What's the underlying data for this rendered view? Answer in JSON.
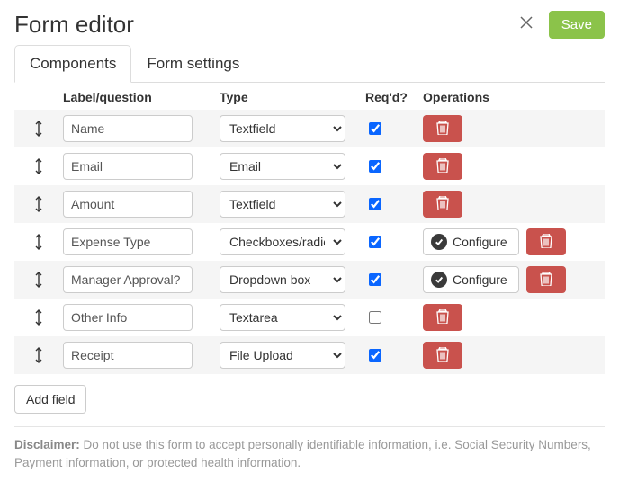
{
  "header": {
    "title": "Form editor",
    "save_label": "Save"
  },
  "tabs": {
    "components": "Components",
    "form_settings": "Form settings"
  },
  "columns": {
    "label": "Label/question",
    "type": "Type",
    "reqd": "Req'd?",
    "ops": "Operations"
  },
  "type_options": [
    "Textfield",
    "Email",
    "Textarea",
    "Checkboxes/radios",
    "Dropdown box",
    "File Upload"
  ],
  "rows": [
    {
      "label": "Name",
      "type": "Textfield",
      "required": true,
      "configurable": false
    },
    {
      "label": "Email",
      "type": "Email",
      "required": true,
      "configurable": false
    },
    {
      "label": "Amount",
      "type": "Textfield",
      "required": true,
      "configurable": false
    },
    {
      "label": "Expense Type",
      "type": "Checkboxes/radios",
      "required": true,
      "configurable": true
    },
    {
      "label": "Manager Approval?",
      "type": "Dropdown box",
      "required": true,
      "configurable": true
    },
    {
      "label": "Other Info",
      "type": "Textarea",
      "required": false,
      "configurable": false
    },
    {
      "label": "Receipt",
      "type": "File Upload",
      "required": true,
      "configurable": false
    }
  ],
  "buttons": {
    "configure": "Configure",
    "add_field": "Add field"
  },
  "disclaimer": {
    "label": "Disclaimer:",
    "text": " Do not use this form to accept personally identifiable information, i.e. Social Security Numbers, Payment information, or protected health information."
  }
}
